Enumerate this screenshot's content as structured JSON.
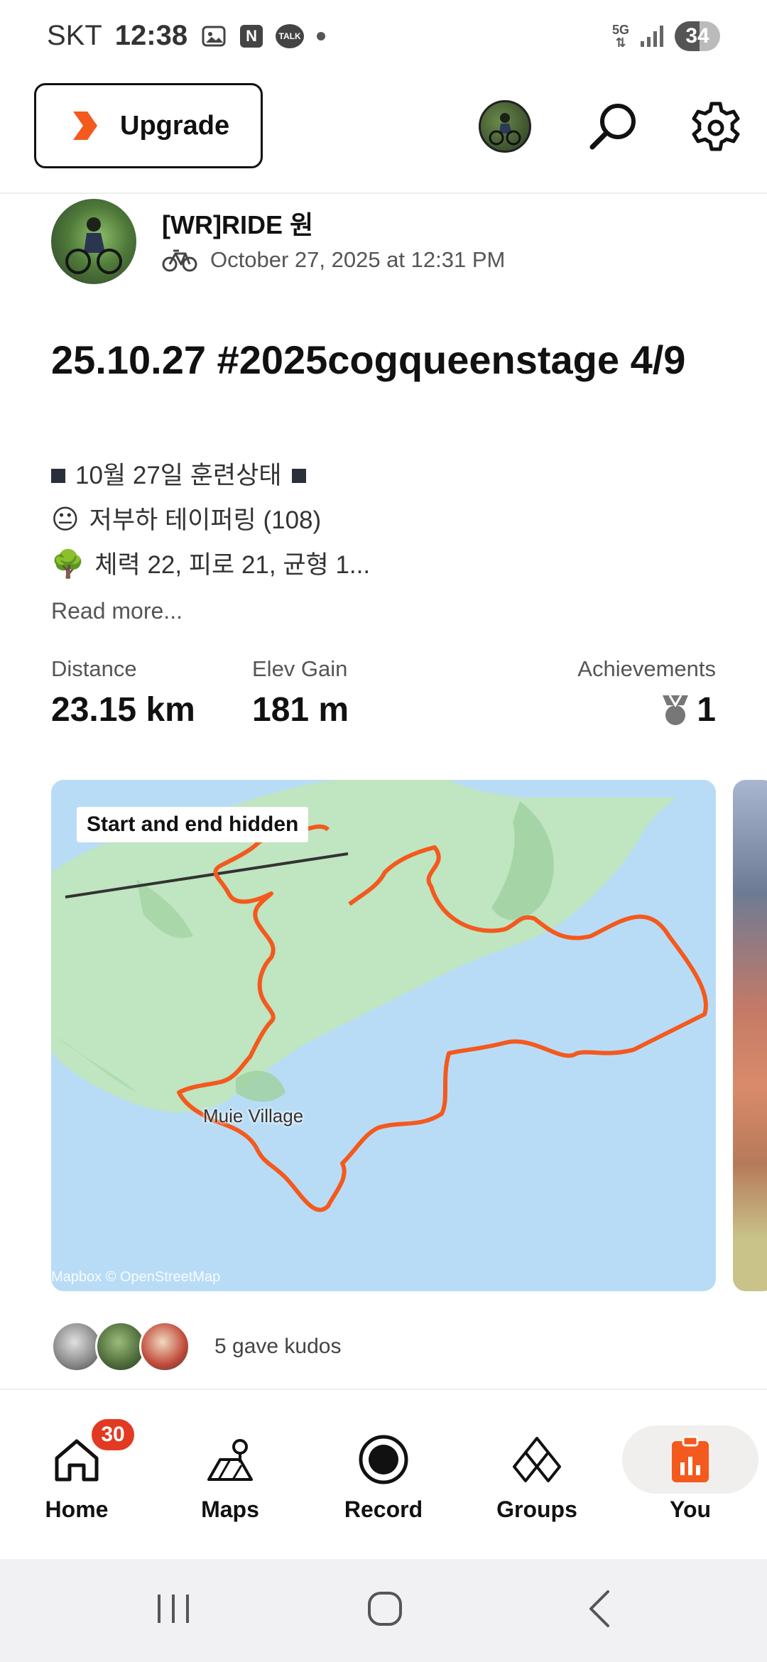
{
  "status_bar": {
    "carrier": "SKT",
    "time": "12:38",
    "network": "5G",
    "battery": "34",
    "talk_icon_text": "TALK",
    "n_icon_text": "N"
  },
  "header": {
    "upgrade_label": "Upgrade"
  },
  "activity": {
    "athlete_name": "[WR]RIDE 원",
    "date": "October 27, 2025 at 12:31 PM",
    "title": "25.10.27 #2025cogqueenstage 4/9",
    "description": {
      "line1": "10월 27일 훈련상태",
      "line2_emoji": "😐",
      "line2": "저부하 테이퍼링 (108)",
      "line3_emoji": "🌳",
      "line3": "체력 22, 피로 21, 균형 1..."
    },
    "read_more": "Read more...",
    "stats": {
      "distance_label": "Distance",
      "distance_value": "23.15 km",
      "elev_label": "Elev Gain",
      "elev_value": "181 m",
      "achievements_label": "Achievements",
      "achievements_value": "1"
    },
    "map": {
      "badge": "Start and end hidden",
      "place_label": "Muie Village",
      "attribution": "Mapbox © OpenStreetMap",
      "route_color": "#f4591d",
      "land_color": "#bfe5c1",
      "water_color": "#b9dcf6"
    },
    "kudos_text": "5 gave kudos"
  },
  "bottom_nav": {
    "home_label": "Home",
    "home_badge": "30",
    "maps_label": "Maps",
    "record_label": "Record",
    "groups_label": "Groups",
    "you_label": "You",
    "active": "You",
    "accent": "#f4591d"
  }
}
